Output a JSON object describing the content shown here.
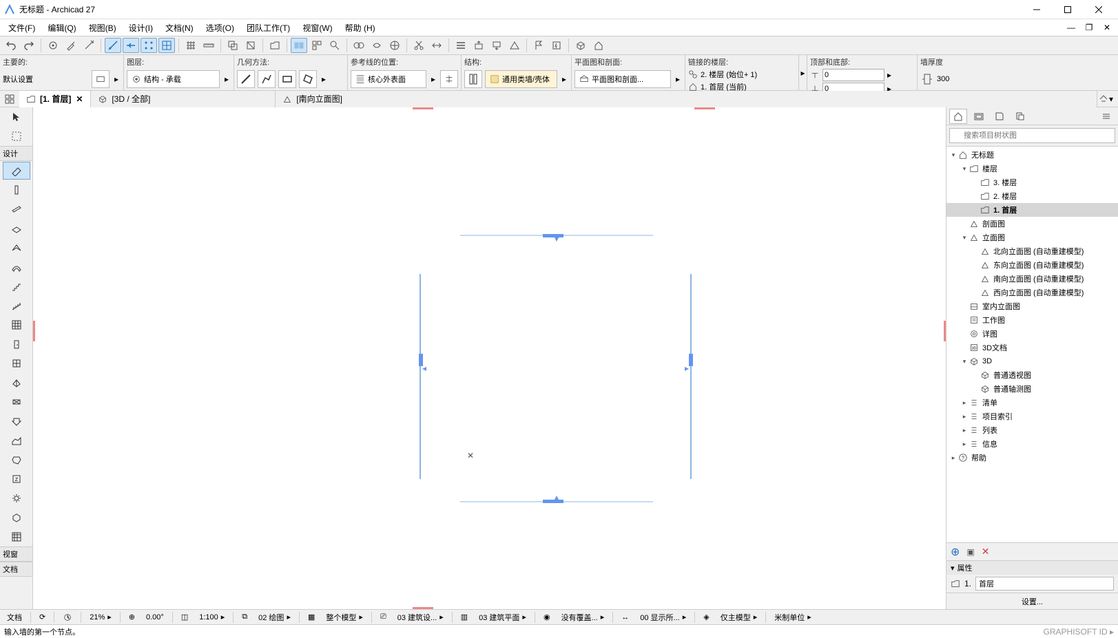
{
  "title": "无标题 - Archicad 27",
  "menu": [
    "文件(F)",
    "编辑(Q)",
    "视图(B)",
    "设计(I)",
    "文档(N)",
    "选项(O)",
    "团队工作(T)",
    "视窗(W)",
    "帮助 (H)"
  ],
  "infobar": {
    "primary_label": "主要的:",
    "primary_value": "默认设置",
    "layer_label": "图层:",
    "layer_value": "结构 - 承载",
    "geom_label": "几何方法:",
    "refline_label": "参考线的位置:",
    "refline_value": "核心外表面",
    "structure_label": "结构:",
    "structure_value": "通用类墙/壳体",
    "plan_label": "平面图和剖面:",
    "plan_value": "平面图和剖面...",
    "linked_label": "链接的楼层:",
    "linked_row1": "2. 楼层 (始位+ 1)",
    "linked_row2": "1. 首层 (当前)",
    "topbot_label": "顶部和底部:",
    "topbot_v1": "0",
    "topbot_v2": "0",
    "thick_label": "墙厚度",
    "thick_value": "300"
  },
  "tabs": [
    {
      "label": "[1. 首层]",
      "active": true,
      "closable": true
    },
    {
      "label": "[3D / 全部]",
      "active": false,
      "closable": false
    },
    {
      "label": "[南向立面图]",
      "active": false,
      "closable": false
    }
  ],
  "toolbox": {
    "section_design": "设计",
    "section_view": "视窗"
  },
  "sidebar": {
    "search_placeholder": "搜索项目树状图",
    "tree": [
      {
        "indent": 0,
        "chev": "▾",
        "icon": "home",
        "label": "无标题"
      },
      {
        "indent": 1,
        "chev": "▾",
        "icon": "folder",
        "label": "楼层"
      },
      {
        "indent": 2,
        "chev": "",
        "icon": "story",
        "label": "3. 楼层"
      },
      {
        "indent": 2,
        "chev": "",
        "icon": "story",
        "label": "2. 楼层"
      },
      {
        "indent": 2,
        "chev": "",
        "icon": "story",
        "label": "1. 首层",
        "selected": true
      },
      {
        "indent": 1,
        "chev": "",
        "icon": "section",
        "label": "剖面图"
      },
      {
        "indent": 1,
        "chev": "▾",
        "icon": "elev",
        "label": "立面图"
      },
      {
        "indent": 2,
        "chev": "",
        "icon": "elev",
        "label": "北向立面图 (自动重建模型)"
      },
      {
        "indent": 2,
        "chev": "",
        "icon": "elev",
        "label": "东向立面图 (自动重建模型)"
      },
      {
        "indent": 2,
        "chev": "",
        "icon": "elev",
        "label": "南向立面图 (自动重建模型)"
      },
      {
        "indent": 2,
        "chev": "",
        "icon": "elev",
        "label": "西向立面图 (自动重建模型)"
      },
      {
        "indent": 1,
        "chev": "",
        "icon": "interior",
        "label": "室内立面图"
      },
      {
        "indent": 1,
        "chev": "",
        "icon": "worksheet",
        "label": "工作图"
      },
      {
        "indent": 1,
        "chev": "",
        "icon": "detail",
        "label": "详图"
      },
      {
        "indent": 1,
        "chev": "",
        "icon": "doc3d",
        "label": "3D文档"
      },
      {
        "indent": 1,
        "chev": "▾",
        "icon": "cube",
        "label": "3D"
      },
      {
        "indent": 2,
        "chev": "",
        "icon": "cube",
        "label": "普通透视图"
      },
      {
        "indent": 2,
        "chev": "",
        "icon": "cube",
        "label": "普通轴测图"
      },
      {
        "indent": 1,
        "chev": "▸",
        "icon": "list",
        "label": "清单"
      },
      {
        "indent": 1,
        "chev": "▸",
        "icon": "list",
        "label": "项目索引"
      },
      {
        "indent": 1,
        "chev": "▸",
        "icon": "list",
        "label": "列表"
      },
      {
        "indent": 1,
        "chev": "▸",
        "icon": "list",
        "label": "信息"
      },
      {
        "indent": 0,
        "chev": "▸",
        "icon": "help",
        "label": "帮助"
      }
    ],
    "props_header": "属性",
    "props_id": "1.",
    "props_name": "首层",
    "settings": "设置..."
  },
  "statusbar": {
    "doc": "文档",
    "zoom": "21%",
    "angle": "0.00°",
    "scale": "1:100",
    "layercomb": "02 绘图",
    "model": "整个模型",
    "planset": "03 建筑设...",
    "plandisp": "03 建筑平面",
    "override": "没有覆盖...",
    "dim": "00 显示所...",
    "only_main": "仅主模型",
    "units": "米制单位"
  },
  "hint": "输入墙的第一个节点。",
  "footer_brand": "GRAPHISOFT ID"
}
